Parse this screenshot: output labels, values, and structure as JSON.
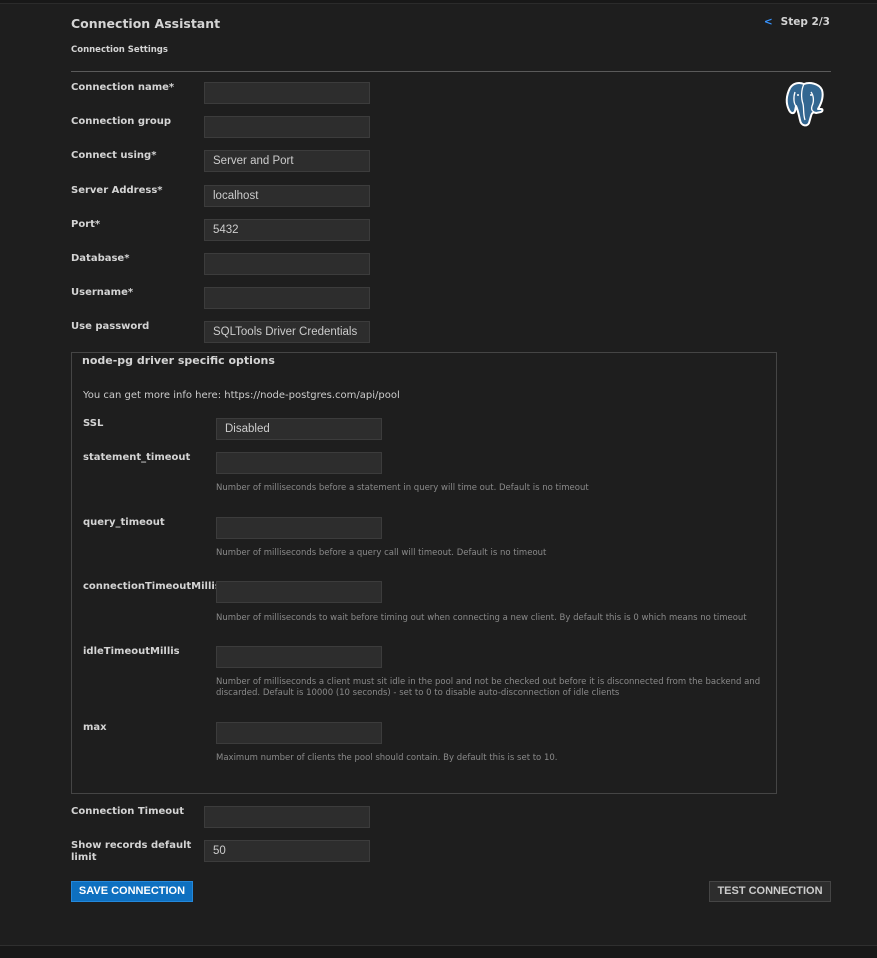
{
  "header": {
    "title": "Connection Assistant",
    "subtitle": "Connection Settings",
    "back_glyph": "<",
    "step": "Step 2/3"
  },
  "logo": {
    "icon": "postgresql-elephant-icon",
    "color": "#336791"
  },
  "form": {
    "fields": [
      {
        "label": "Connection name*",
        "value": "",
        "type": "text"
      },
      {
        "label": "Connection group",
        "value": "",
        "type": "text"
      },
      {
        "label": "Connect using*",
        "value": "Server and Port",
        "type": "select"
      },
      {
        "label": "Server Address*",
        "value": "localhost",
        "type": "text"
      },
      {
        "label": "Port*",
        "value": "5432",
        "type": "number"
      },
      {
        "label": "Database*",
        "value": "",
        "type": "text"
      },
      {
        "label": "Username*",
        "value": "",
        "type": "text"
      },
      {
        "label": "Use password",
        "value": "SQLTools Driver Credentials",
        "type": "select"
      }
    ]
  },
  "driver": {
    "legend": "node-pg driver specific options",
    "info": "You can get more info here: https://node-postgres.com/api/pool",
    "fields": [
      {
        "label": "SSL",
        "value": "Disabled",
        "type": "select",
        "help": ""
      },
      {
        "label": "statement_timeout",
        "value": "",
        "type": "number",
        "help": "Number of milliseconds before a statement in query will time out. Default is no timeout"
      },
      {
        "label": "query_timeout",
        "value": "",
        "type": "number",
        "help": "Number of milliseconds before a query call will timeout. Default is no timeout"
      },
      {
        "label": "connectionTimeoutMillis",
        "value": "",
        "type": "number",
        "help": "Number of milliseconds to wait before timing out when connecting a new client. By default this is 0 which means no timeout"
      },
      {
        "label": "idleTimeoutMillis",
        "value": "",
        "type": "number",
        "help": "Number of milliseconds a client must sit idle in the pool and not be checked out before it is disconnected from the backend and discarded. Default is 10000 (10 seconds) - set to 0 to disable auto-disconnection of idle clients"
      },
      {
        "label": "max",
        "value": "",
        "type": "number",
        "help": "Maximum number of clients the pool should contain. By default this is set to 10."
      }
    ]
  },
  "footer_fields": [
    {
      "label": "Connection Timeout",
      "value": ""
    },
    {
      "label": "Show records default limit",
      "value": "50"
    }
  ],
  "buttons": {
    "save": "SAVE CONNECTION",
    "test": "TEST CONNECTION"
  },
  "colors": {
    "accent": "#0e70c0",
    "link": "#3794ff",
    "background": "#1e1e1e",
    "input_bg": "#2d2d2d"
  }
}
